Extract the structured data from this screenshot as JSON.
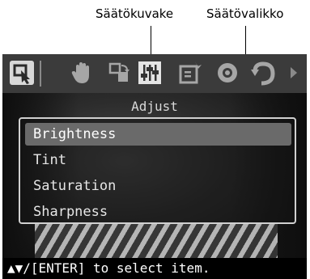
{
  "callouts": {
    "icon_label": "Säätökuvake",
    "menu_label": "Säätövalikko"
  },
  "toolbar": {
    "icons": [
      "select-icon",
      "hand-icon",
      "rotate-icon",
      "adjust-sliders-icon",
      "edit-frame-icon",
      "red-eye-icon",
      "undo-icon",
      "scroll-right-icon"
    ],
    "selected_icon": "adjust-sliders-icon"
  },
  "menu": {
    "title": "Adjust",
    "items": [
      {
        "label": "Brightness",
        "selected": true
      },
      {
        "label": "Tint",
        "selected": false
      },
      {
        "label": "Saturation",
        "selected": false
      },
      {
        "label": "Sharpness",
        "selected": false
      }
    ]
  },
  "status": {
    "hint": "▲▼/[ENTER] to select item."
  },
  "colors": {
    "toolbar_bg": "#3b3b3b",
    "selected_row": "#6a6a6a",
    "menu_border": "#d0d0d0",
    "status_bg": "#000000"
  }
}
